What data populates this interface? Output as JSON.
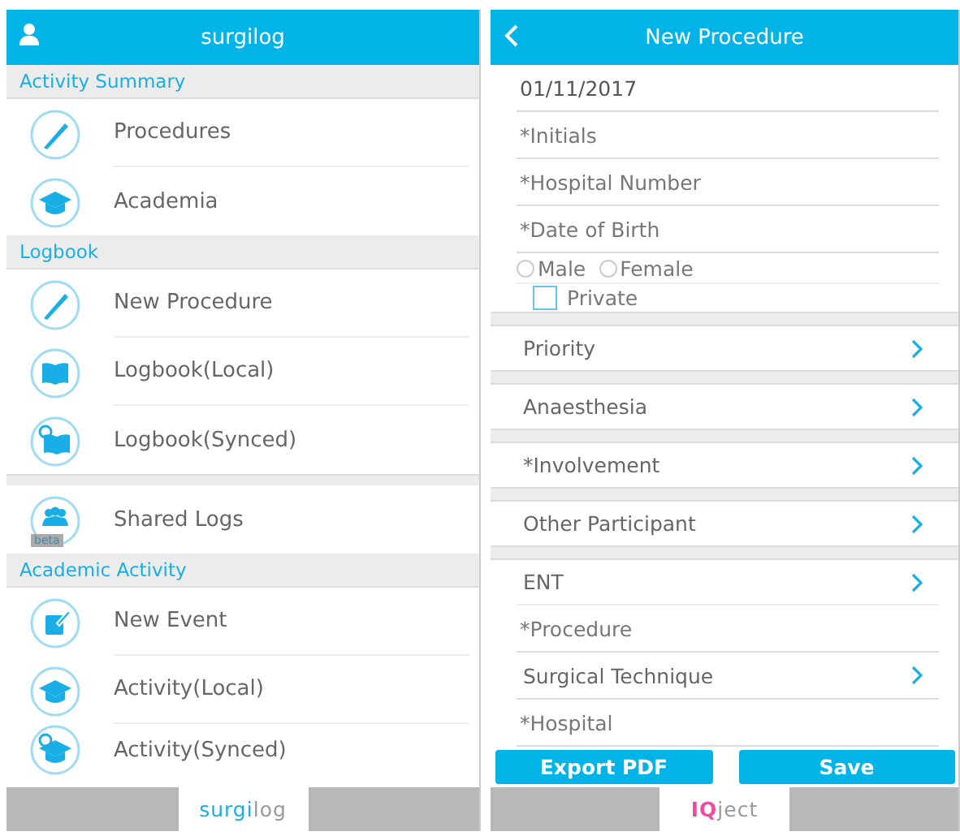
{
  "menu_screen": {
    "title": "surgilog",
    "sections": [
      {
        "heading": "Activity Summary",
        "items": [
          {
            "label": "Procedures"
          },
          {
            "label": "Academia"
          }
        ]
      },
      {
        "heading": "Logbook",
        "items": [
          {
            "label": "New Procedure"
          },
          {
            "label": "Logbook(Local)"
          },
          {
            "label": "Logbook(Synced)"
          }
        ]
      },
      {
        "items": [
          {
            "label": "Shared Logs",
            "badge": "beta"
          }
        ]
      },
      {
        "heading": "Academic Activity",
        "items": [
          {
            "label": "New Event"
          },
          {
            "label": "Activity(Local)"
          },
          {
            "label": "Activity(Synced)"
          }
        ]
      }
    ],
    "footer_tab": {
      "accent": "surgi",
      "rest": "log"
    }
  },
  "form_screen": {
    "title": "New Procedure",
    "rows": [
      {
        "kind": "field",
        "value": "01/11/2017"
      },
      {
        "kind": "field",
        "placeholder": "*Initials"
      },
      {
        "kind": "field",
        "placeholder": "*Hospital Number"
      },
      {
        "kind": "field",
        "placeholder": "*Date of Birth"
      },
      {
        "kind": "radio",
        "options": [
          {
            "label": "Male",
            "selected": false
          },
          {
            "label": "Female",
            "selected": false
          }
        ]
      },
      {
        "kind": "checkbox",
        "label": "Private",
        "checked": false
      },
      {
        "kind": "group-select",
        "label": "Priority"
      },
      {
        "kind": "group-select",
        "label": "Anaesthesia"
      },
      {
        "kind": "group-select",
        "label": "*Involvement"
      },
      {
        "kind": "group-select",
        "label": "Other Participant"
      },
      {
        "kind": "group-select",
        "label": "ENT"
      },
      {
        "kind": "field",
        "placeholder": "*Procedure"
      },
      {
        "kind": "select",
        "label": "Surgical Technique"
      },
      {
        "kind": "field",
        "placeholder": "*Hospital"
      }
    ],
    "buttons": [
      "Export PDF",
      "Save"
    ],
    "footer_tab": {
      "accent": "IQ",
      "rest": "ject"
    }
  }
}
